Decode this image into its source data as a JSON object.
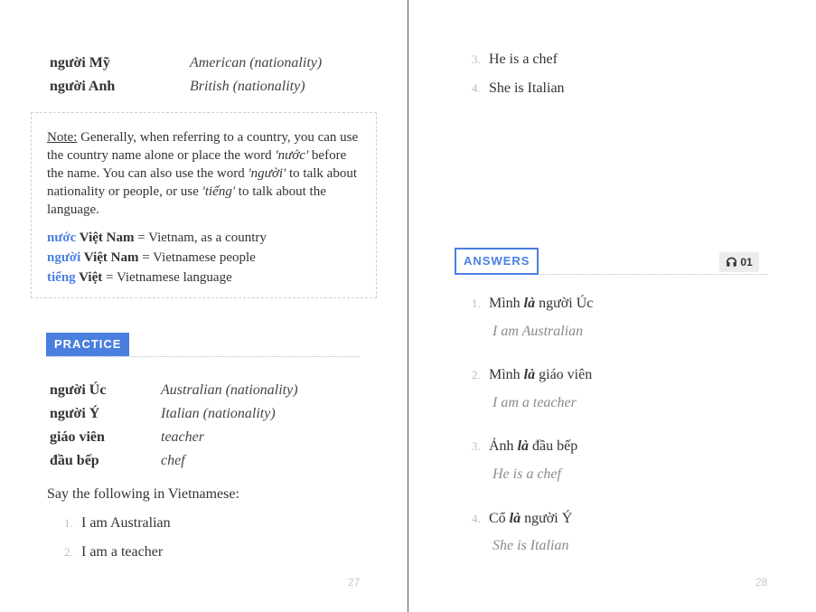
{
  "left_page": {
    "vocab_top": [
      {
        "vn": "người Mỹ",
        "en": "American (nationality)"
      },
      {
        "vn": "người Anh",
        "en": "British (nationality)"
      }
    ],
    "note": {
      "label": "Note:",
      "t1": " Generally, when referring to a country, you can use the country name alone or place the word ",
      "w1": "'nước'",
      "t2": " before the name. You can also use the word ",
      "w2": "'người'",
      "t3": " to talk about nationality or people, or use ",
      "w3": "'tiếng'",
      "t4": " to talk about the language.",
      "examples": [
        {
          "kw": "nước",
          "bold": " Việt Nam",
          "rest": " = Vietnam, as a country"
        },
        {
          "kw": "người",
          "bold": " Việt Nam",
          "rest": " = Vietnamese people"
        },
        {
          "kw": "tiếng",
          "bold": " Việt",
          "rest": " = Vietnamese language"
        }
      ]
    },
    "practice_label": "PRACTICE",
    "vocab_practice": [
      {
        "vn": "người Úc",
        "en": "Australian (nationality)"
      },
      {
        "vn": "người Ý",
        "en": "Italian (nationality)"
      },
      {
        "vn": "giáo viên",
        "en": "teacher"
      },
      {
        "vn": "đầu bếp",
        "en": "chef"
      }
    ],
    "instruction": "Say the following in Vietnamese:",
    "exercises": [
      {
        "num": "1.",
        "text": "I am Australian"
      },
      {
        "num": "2.",
        "text": "I am a teacher"
      }
    ],
    "page_number": "27"
  },
  "right_page": {
    "exercises": [
      {
        "num": "3.",
        "text": "He is a chef"
      },
      {
        "num": "4.",
        "text": "She is Italian"
      }
    ],
    "answers_label": "ANSWERS",
    "audio_icon": "headphones-icon",
    "audio_track": "01",
    "answers": [
      {
        "num": "1.",
        "pre": "Mình ",
        "key": "là",
        "post": " người Úc",
        "en": "I am Australian"
      },
      {
        "num": "2.",
        "pre": "Mình ",
        "key": "là",
        "post": " giáo viên",
        "en": "I am a teacher"
      },
      {
        "num": "3.",
        "pre": "Ảnh ",
        "key": "là",
        "post": " đầu bếp",
        "en": "He is a chef"
      },
      {
        "num": "4.",
        "pre": "Cổ ",
        "key": "là",
        "post": " người Ý",
        "en": "She is Italian"
      }
    ],
    "page_number": "28"
  },
  "colors": {
    "accent": "#4a7fe0",
    "muted_number": "#bdbdbd",
    "answer_translation": "#8a8a8a"
  }
}
